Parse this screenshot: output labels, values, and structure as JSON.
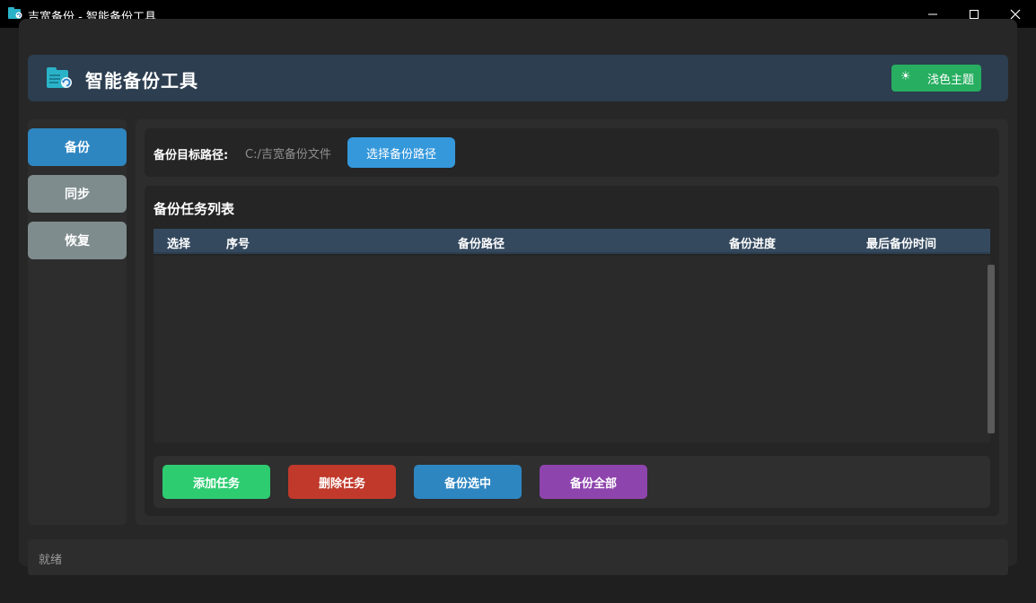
{
  "window": {
    "title": "吉宽备份 - 智能备份工具",
    "icon": "folder-sync-icon"
  },
  "header": {
    "title": "智能备份工具",
    "theme_icon": "sun-icon",
    "theme_label": "浅色主题"
  },
  "sidebar": {
    "items": [
      {
        "label": "备份",
        "active": true
      },
      {
        "label": "同步",
        "active": false
      },
      {
        "label": "恢复",
        "active": false
      }
    ]
  },
  "backup_path": {
    "label": "备份目标路径:",
    "value": "C:/吉宽备份文件",
    "button_label": "选择备份路径"
  },
  "tasks": {
    "title": "备份任务列表",
    "columns": [
      "选择",
      "序号",
      "备份路径",
      "备份进度",
      "最后备份时间"
    ],
    "rows": []
  },
  "actions": {
    "add": "添加任务",
    "delete": "删除任务",
    "backup_selected": "备份选中",
    "backup_all": "备份全部"
  },
  "status": {
    "text": "就绪"
  },
  "colors": {
    "accent_blue": "#3498db",
    "header_bg": "#2c3e50",
    "green": "#2ecc71",
    "red": "#c0392b",
    "purple": "#8e44ad"
  }
}
